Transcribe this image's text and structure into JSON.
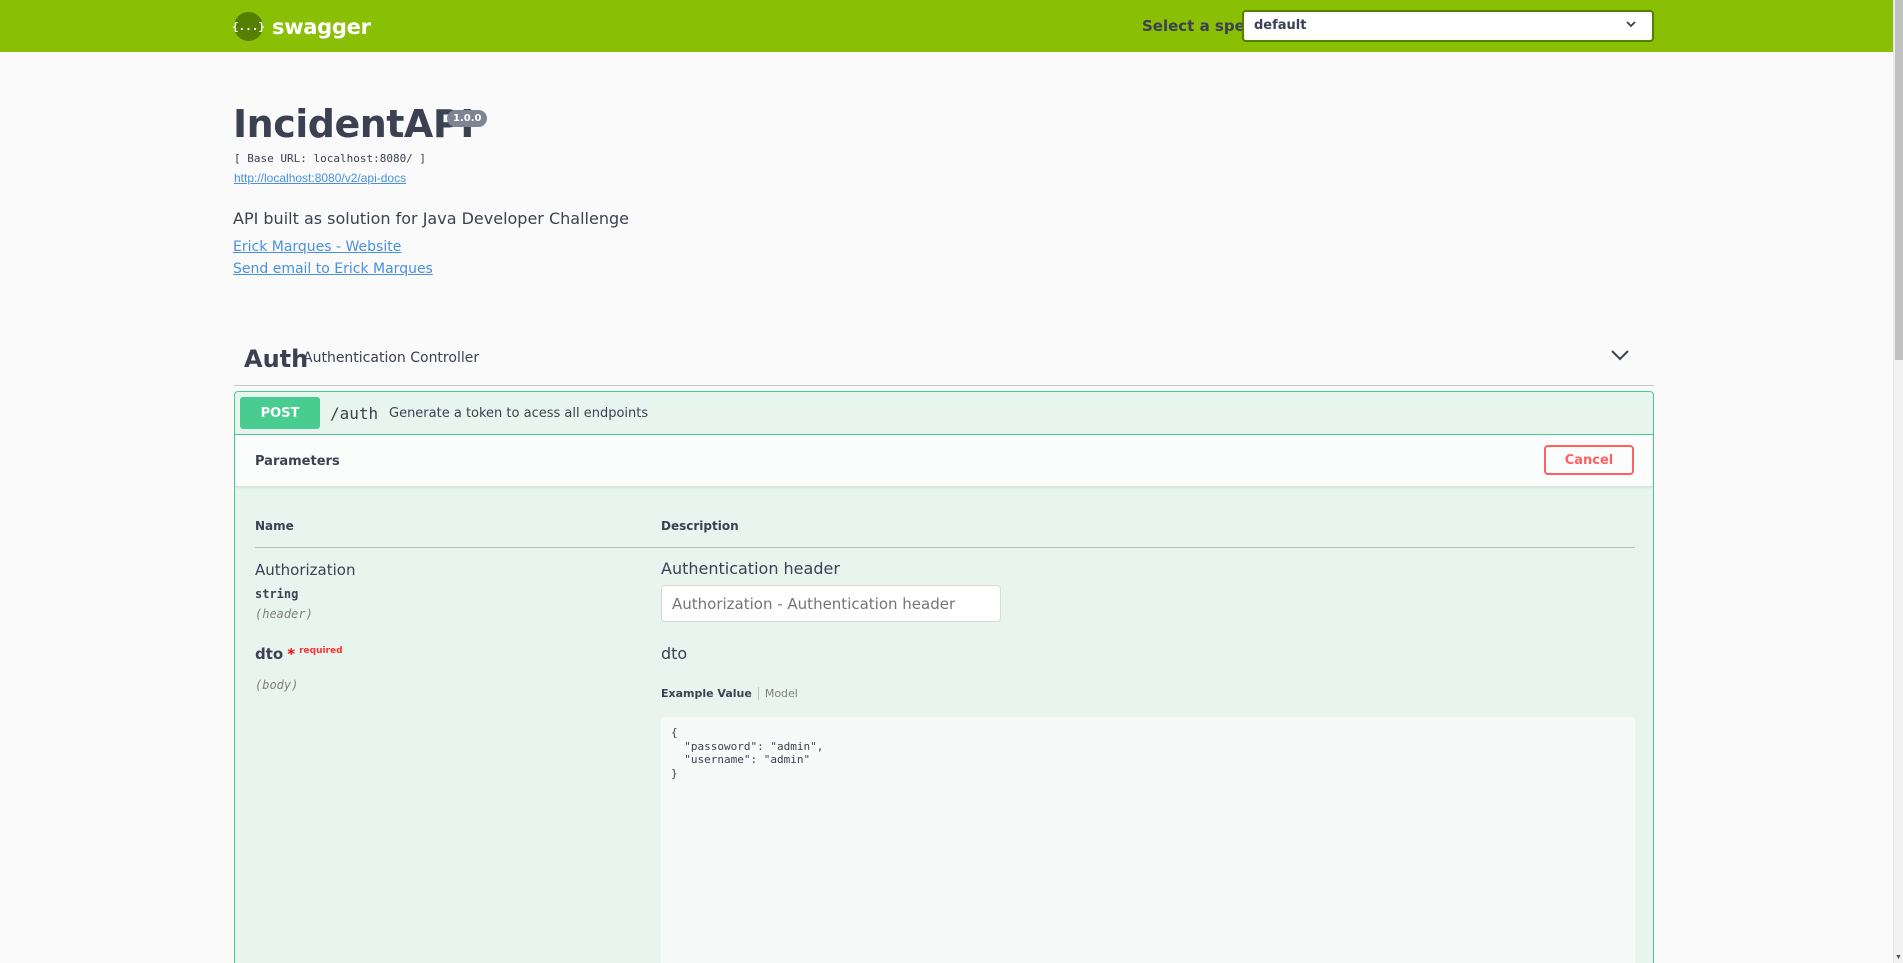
{
  "topbar": {
    "logo_glyph": "{...}",
    "logo_text": "swagger",
    "spec_label": "Select a spec",
    "spec_selected": "default",
    "bg_color": "#89bf04"
  },
  "info": {
    "title": "IncidentAPI",
    "version": "1.0.0",
    "base_url": "[ Base URL: localhost:8080/ ]",
    "docs_link": "http://localhost:8080/v2/api-docs",
    "description": "API built as solution for Java Developer Challenge",
    "contact_links": [
      "Erick Marques - Website",
      "Send email to Erick Marques"
    ]
  },
  "tag": {
    "name": "Auth",
    "description": "Authentication Controller",
    "icon": "chevron-down-icon"
  },
  "operation": {
    "method": "POST",
    "path": "/auth",
    "summary": "Generate a token to acess all endpoints",
    "method_color": "#49cc90",
    "params_title": "Parameters",
    "cancel_label": "Cancel",
    "columns": [
      "Name",
      "Description"
    ],
    "params": [
      {
        "name": "Authorization",
        "type": "string",
        "in": "(header)",
        "description": "Authentication header",
        "placeholder": "Authorization - Authentication header"
      },
      {
        "name": "dto",
        "required_mark": "*",
        "required_label": "required",
        "in": "(body)",
        "description": "dto",
        "tabs": [
          "Example Value",
          "Model"
        ],
        "example": "{\n  \"passoword\": \"admin\",\n  \"username\": \"admin\"\n}"
      }
    ]
  }
}
